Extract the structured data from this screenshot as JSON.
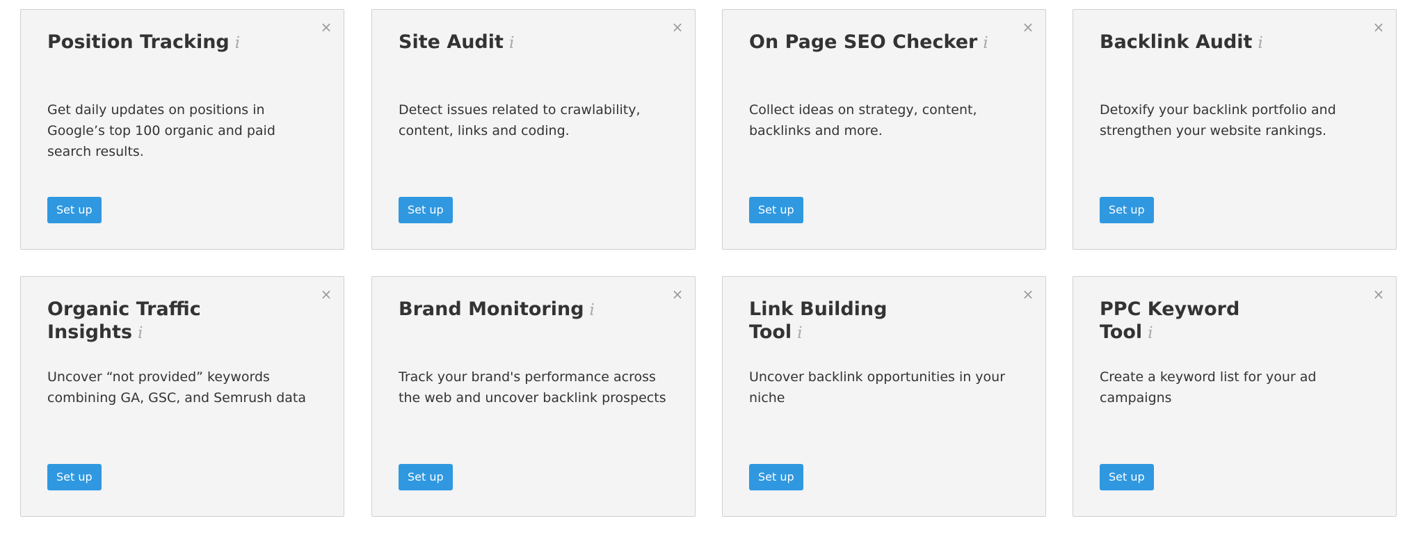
{
  "cards": [
    {
      "title": "Position Tracking",
      "title_lines": [],
      "description": "Get daily updates on positions in Google’s top 100 organic and paid search results.",
      "button": "Set up",
      "info_glyph": "i",
      "close_glyph": "×"
    },
    {
      "title": "Site Audit",
      "title_lines": [],
      "description": "Detect issues related to crawlability, content, links and coding.",
      "button": "Set up",
      "info_glyph": "i",
      "close_glyph": "×"
    },
    {
      "title": "On Page SEO Checker",
      "title_lines": [],
      "description": "Collect ideas on strategy, content, backlinks and more.",
      "button": "Set up",
      "info_glyph": "i",
      "close_glyph": "×"
    },
    {
      "title": "Backlink Audit",
      "title_lines": [],
      "description": "Detoxify your backlink portfolio and strengthen your website rankings.",
      "button": "Set up",
      "info_glyph": "i",
      "close_glyph": "×"
    },
    {
      "title": "",
      "title_lines": [
        "Organic Traffic",
        "Insights"
      ],
      "description": "Uncover “not provided” keywords combining GA, GSC, and Semrush data",
      "button": "Set up",
      "info_glyph": "i",
      "close_glyph": "×"
    },
    {
      "title": "Brand Monitoring",
      "title_lines": [],
      "description": "Track your brand's performance across the web and uncover backlink prospects",
      "button": "Set up",
      "info_glyph": "i",
      "close_glyph": "×"
    },
    {
      "title": "",
      "title_lines": [
        "Link Building",
        "Tool"
      ],
      "description": "Uncover backlink opportunities in your niche",
      "button": "Set up",
      "info_glyph": "i",
      "close_glyph": "×"
    },
    {
      "title": "",
      "title_lines": [
        "PPC Keyword",
        "Tool"
      ],
      "description": "Create a keyword list for your ad campaigns",
      "button": "Set up",
      "info_glyph": "i",
      "close_glyph": "×"
    }
  ],
  "colors": {
    "card_bg": "#f4f4f4",
    "card_border": "#cfcfcf",
    "button_bg": "#2f98e0",
    "text": "#333333",
    "muted": "#a8a8a8"
  }
}
